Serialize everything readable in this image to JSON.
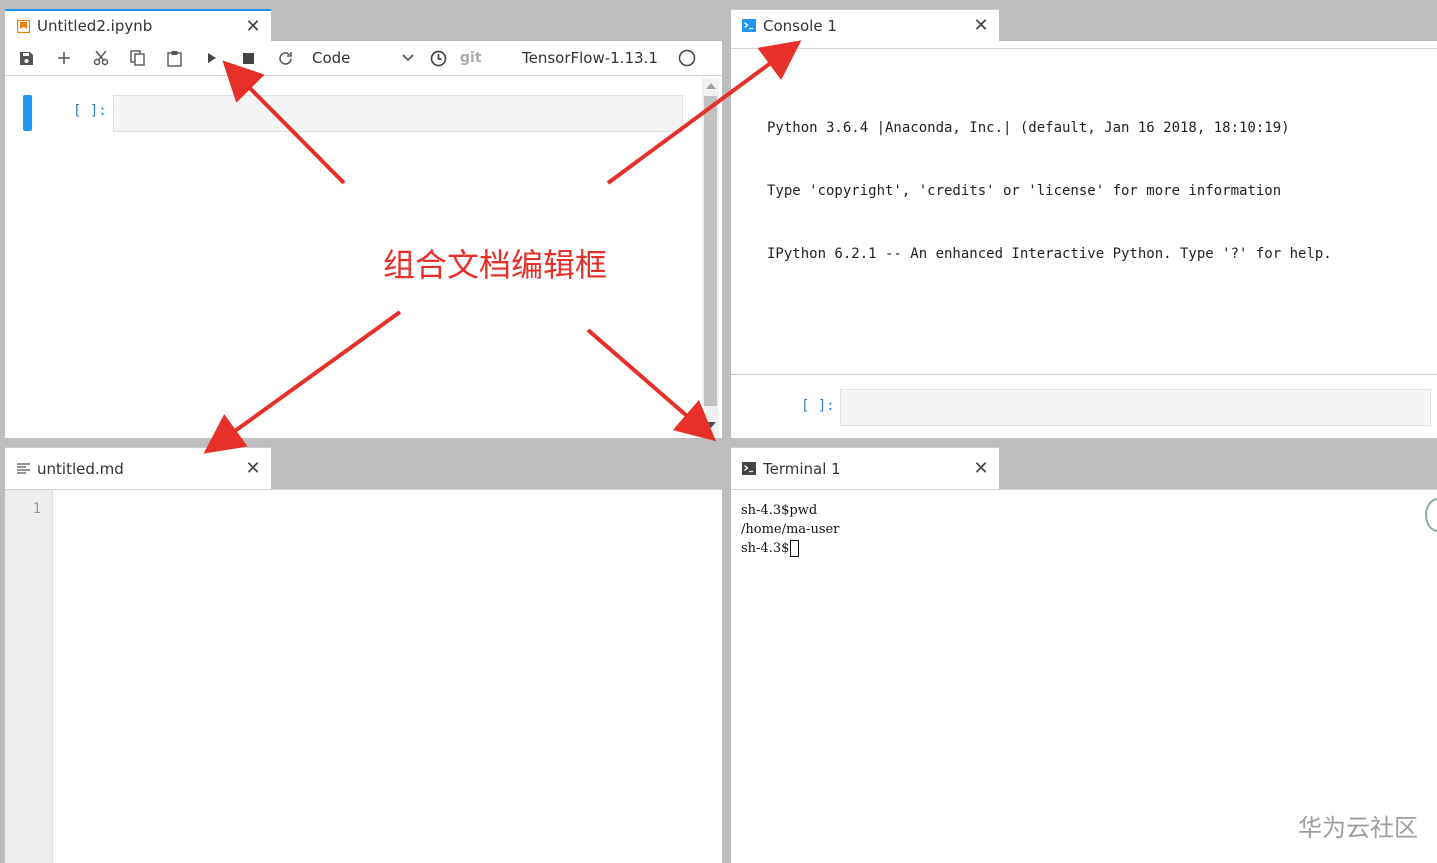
{
  "notebook": {
    "tab_label": "Untitled2.ipynb",
    "cell_type": "Code",
    "git_label": "git",
    "kernel_name": "TensorFlow-1.13.1",
    "cell_prompt": "[ ]:"
  },
  "console": {
    "tab_label": "Console 1",
    "banner": [
      "Python 3.6.4 |Anaconda, Inc.| (default, Jan 16 2018, 18:10:19)",
      "Type 'copyright', 'credits' or 'license' for more information",
      "IPython 6.2.1 -- An enhanced Interactive Python. Type '?' for help."
    ],
    "prompt": "[ ]:"
  },
  "markdown": {
    "tab_label": "untitled.md",
    "line_number": "1"
  },
  "terminal": {
    "tab_label": "Terminal 1",
    "lines": [
      "sh-4.3$pwd",
      "/home/ma-user",
      "sh-4.3$"
    ]
  },
  "annotation": {
    "label": "组合文档编辑框",
    "color": "#e8302a"
  },
  "watermark": "华为云社区",
  "icons": {
    "save": "save-icon",
    "add": "plus-icon",
    "cut": "scissors-icon",
    "copy": "copy-icon",
    "paste": "paste-icon",
    "run": "play-icon",
    "stop": "stop-icon",
    "restart": "refresh-icon",
    "history": "clock-icon",
    "kernel_status": "circle-icon"
  },
  "colors": {
    "accent": "#2196f3",
    "prompt": "#307fc1",
    "notebook_icon": "#f57c00"
  }
}
